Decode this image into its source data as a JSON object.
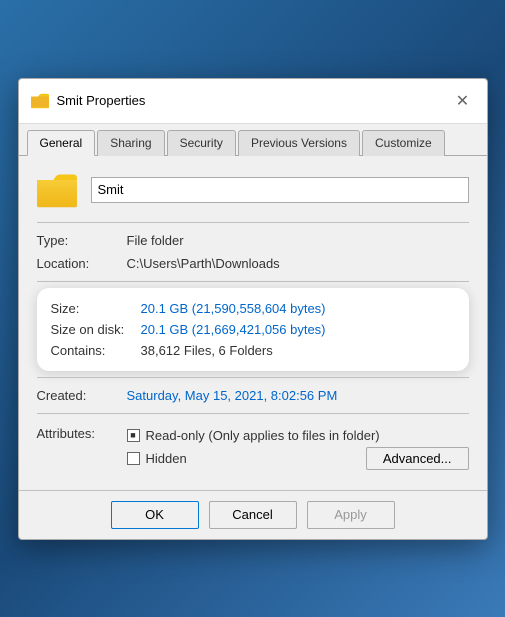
{
  "dialog": {
    "title": "Smit Properties",
    "close_label": "✕"
  },
  "tabs": [
    {
      "label": "General",
      "active": true
    },
    {
      "label": "Sharing",
      "active": false
    },
    {
      "label": "Security",
      "active": false
    },
    {
      "label": "Previous Versions",
      "active": false
    },
    {
      "label": "Customize",
      "active": false
    }
  ],
  "folder": {
    "name_value": "Smit"
  },
  "properties": {
    "type_label": "Type:",
    "type_value": "File folder",
    "location_label": "Location:",
    "location_value": "C:\\Users\\Parth\\Downloads",
    "size_label": "Size:",
    "size_value": "20.1 GB (21,590,558,604 bytes)",
    "size_on_disk_label": "Size on disk:",
    "size_on_disk_value": "20.1 GB (21,669,421,056 bytes)",
    "contains_label": "Contains:",
    "contains_value": "38,612 Files, 6 Folders",
    "created_label": "Created:",
    "created_value": "Saturday, May 15, 2021, 8:02:56 PM",
    "attributes_label": "Attributes:",
    "readonly_label": "Read-only (Only applies to files in folder)",
    "hidden_label": "Hidden",
    "advanced_label": "Advanced..."
  },
  "buttons": {
    "ok_label": "OK",
    "cancel_label": "Cancel",
    "apply_label": "Apply"
  }
}
